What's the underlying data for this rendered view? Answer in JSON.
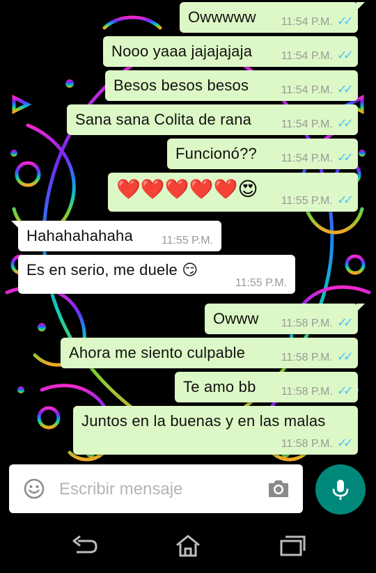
{
  "colors": {
    "outgoing_bubble": "#dcf8c6",
    "incoming_bubble": "#ffffff",
    "read_ticks": "#4fc3f7",
    "mic_button": "#00897b",
    "wallpaper_bg": "#000000"
  },
  "messages": [
    {
      "direction": "out",
      "text": "Owwwww",
      "time": "11:54 P.M.",
      "status_icon": "double-check-icon"
    },
    {
      "direction": "out",
      "text": "Nooo yaaa jajajajaja",
      "time": "11:54 P.M.",
      "status_icon": "double-check-icon"
    },
    {
      "direction": "out",
      "text": "Besos besos besos",
      "time": "11:54 P.M.",
      "status_icon": "double-check-icon"
    },
    {
      "direction": "out",
      "text": "Sana sana Colita de rana",
      "time": "11:54 P.M.",
      "status_icon": "double-check-icon"
    },
    {
      "direction": "out",
      "text": "Funcionó??",
      "time": "11:54 P.M.",
      "status_icon": "double-check-icon"
    },
    {
      "direction": "out",
      "text": "❤️❤️❤️❤️❤️😍",
      "time": "11:55 P.M.",
      "status_icon": "double-check-icon"
    },
    {
      "direction": "in",
      "text": "Hahahahahaha",
      "time": "11:55 P.M."
    },
    {
      "direction": "in",
      "text": "Es en serio, me duele 😏",
      "time": "11:55 P.M."
    },
    {
      "direction": "out",
      "text": "Owww",
      "time": "11:58 P.M.",
      "status_icon": "double-check-icon"
    },
    {
      "direction": "out",
      "text": "Ahora me siento culpable",
      "time": "11:58 P.M.",
      "status_icon": "double-check-icon"
    },
    {
      "direction": "out",
      "text": "Te amo bb",
      "time": "11:58 P.M.",
      "status_icon": "double-check-icon"
    },
    {
      "direction": "out",
      "text": "Juntos en la buenas y en las malas",
      "time": "11:58 P.M.",
      "status_icon": "double-check-icon"
    }
  ],
  "composer": {
    "placeholder": "Escribir mensaje",
    "emoji_icon": "smiley-icon",
    "attach_icon": "camera-icon",
    "send_icon": "microphone-icon"
  },
  "navbar": {
    "back_icon": "back-icon",
    "home_icon": "home-icon",
    "recents_icon": "recents-icon"
  }
}
